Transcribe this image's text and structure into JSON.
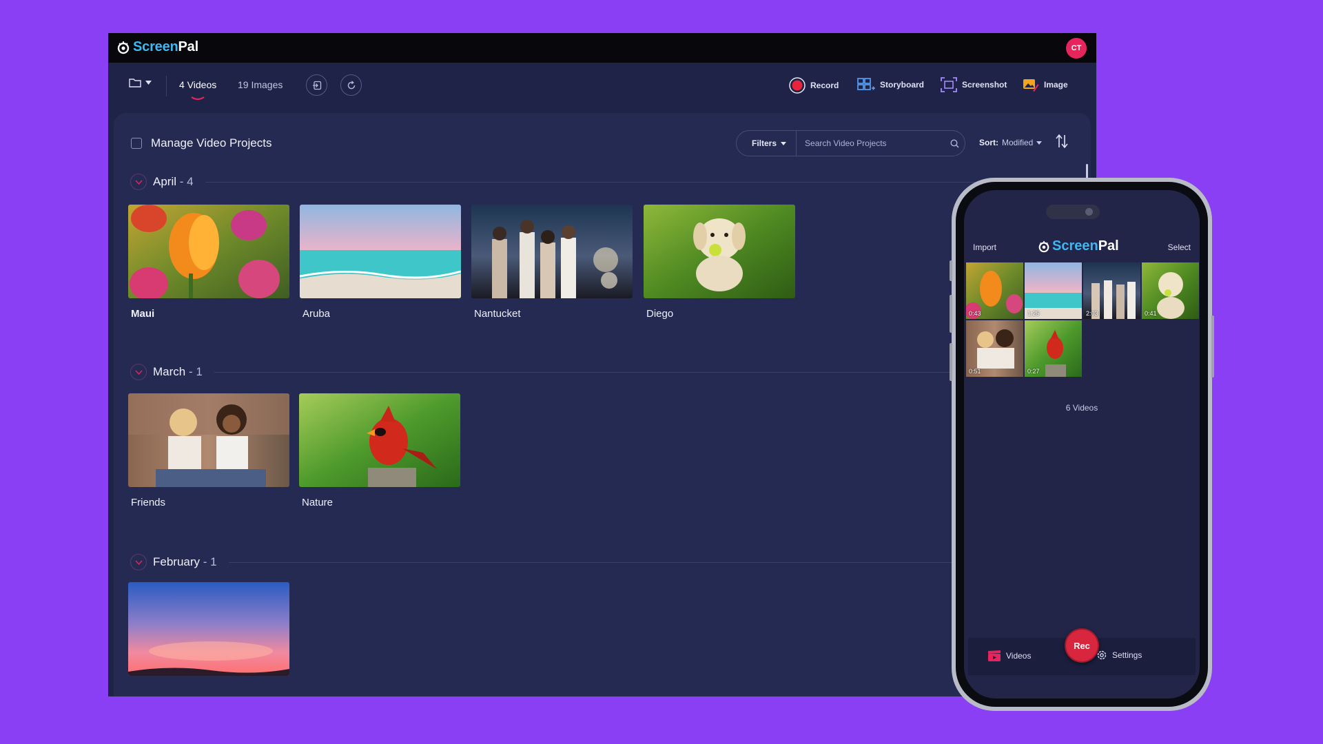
{
  "app": {
    "logo_part1": "Screen",
    "logo_part2": "Pal",
    "avatar_initials": "CT",
    "brand_color": "#3fb8f2",
    "accent_color": "#e8245d"
  },
  "toolbar": {
    "tabs": [
      {
        "label": "4 Videos",
        "active": true
      },
      {
        "label": "19 Images",
        "active": false
      }
    ],
    "tools": [
      {
        "label": "Record",
        "icon": "record-icon"
      },
      {
        "label": "Storyboard",
        "icon": "storyboard-icon"
      },
      {
        "label": "Screenshot",
        "icon": "screenshot-icon"
      },
      {
        "label": "Image",
        "icon": "image-icon"
      }
    ]
  },
  "panel": {
    "manage_label": "Manage Video Projects",
    "filters_label": "Filters",
    "search_placeholder": "Search Video Projects",
    "sort_label": "Sort:",
    "sort_value": "Modified"
  },
  "sections": [
    {
      "title": "April",
      "count": "- 4",
      "items": [
        "Maui",
        "Aruba",
        "Nantucket",
        "Diego"
      ]
    },
    {
      "title": "March",
      "count": "- 1",
      "items": [
        "Friends",
        "Nature"
      ]
    },
    {
      "title": "February",
      "count": "- 1",
      "items": []
    }
  ],
  "phone": {
    "import_label": "Import",
    "select_label": "Select",
    "durations": [
      "0:43",
      "1:25",
      "2:03",
      "0:41",
      "0:51",
      "0:27"
    ],
    "video_count": "6 Videos",
    "tab_videos": "Videos",
    "rec_label": "Rec",
    "tab_settings": "Settings"
  }
}
